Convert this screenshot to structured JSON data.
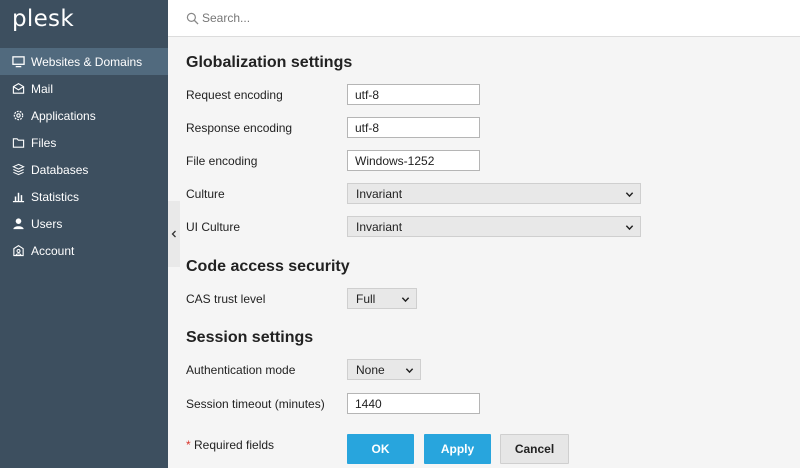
{
  "brand": {
    "logo_text": "plesk"
  },
  "sidebar": {
    "items": [
      {
        "label": "Websites & Domains",
        "icon": "monitor-icon",
        "active": true
      },
      {
        "label": "Mail",
        "icon": "mail-icon",
        "active": false
      },
      {
        "label": "Applications",
        "icon": "gear-icon",
        "active": false
      },
      {
        "label": "Files",
        "icon": "folder-icon",
        "active": false
      },
      {
        "label": "Databases",
        "icon": "database-icon",
        "active": false
      },
      {
        "label": "Statistics",
        "icon": "bar-chart-icon",
        "active": false
      },
      {
        "label": "Users",
        "icon": "user-icon",
        "active": false
      },
      {
        "label": "Account",
        "icon": "account-icon",
        "active": false
      }
    ]
  },
  "search": {
    "placeholder": "Search..."
  },
  "globalization": {
    "title": "Globalization settings",
    "request_encoding": {
      "label": "Request encoding",
      "value": "utf-8"
    },
    "response_encoding": {
      "label": "Response encoding",
      "value": "utf-8"
    },
    "file_encoding": {
      "label": "File encoding",
      "value": "Windows-1252"
    },
    "culture": {
      "label": "Culture",
      "value": "Invariant"
    },
    "ui_culture": {
      "label": "UI Culture",
      "value": "Invariant"
    }
  },
  "cas": {
    "title": "Code access security",
    "trust_level": {
      "label": "CAS trust level",
      "value": "Full"
    }
  },
  "session": {
    "title": "Session settings",
    "auth_mode": {
      "label": "Authentication mode",
      "value": "None"
    },
    "timeout": {
      "label": "Session timeout (minutes)",
      "value": "1440"
    }
  },
  "footer": {
    "required_star": "*",
    "required_text": "Required fields",
    "ok_label": "OK",
    "apply_label": "Apply",
    "cancel_label": "Cancel"
  },
  "colors": {
    "sidebar_bg": "#3d4f5f",
    "sidebar_active": "#516a7e",
    "primary_button": "#28a5dd",
    "required_star": "#d9342b"
  }
}
